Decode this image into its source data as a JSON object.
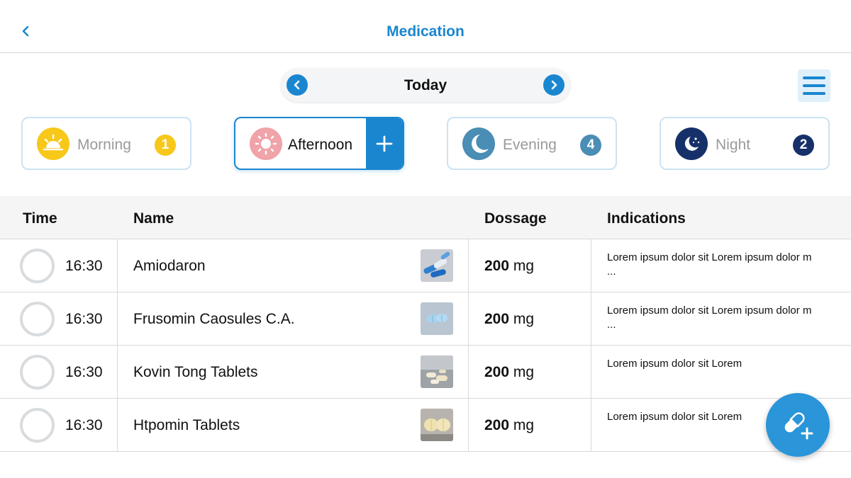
{
  "header": {
    "title": "Medication",
    "back_icon": "chevron-left-icon"
  },
  "date_nav": {
    "label": "Today",
    "prev_icon": "chevron-left-icon",
    "next_icon": "chevron-right-icon"
  },
  "menu_icon": "hamburger-menu-icon",
  "periods": [
    {
      "label": "Morning",
      "count": "1",
      "icon": "sunrise-icon",
      "icon_color": "#f7c81a",
      "badge_color": "#f7c81a",
      "active": false
    },
    {
      "label": "Afternoon",
      "count": "",
      "icon": "sun-icon",
      "icon_color": "#f0a3a8",
      "badge_color": "",
      "active": true,
      "add_icon": "plus-icon"
    },
    {
      "label": "Evening",
      "count": "4",
      "icon": "moon-icon",
      "icon_color": "#4a8db5",
      "badge_color": "#4a8db5",
      "active": false
    },
    {
      "label": "Night",
      "count": "2",
      "icon": "moon-stars-icon",
      "icon_color": "#16306a",
      "badge_color": "#16306a",
      "active": false
    }
  ],
  "table": {
    "headers": {
      "time": "Time",
      "name": "Name",
      "dosage": "Dossage",
      "indications": "Indications"
    },
    "rows": [
      {
        "time": "16:30",
        "name": "Amiodaron",
        "dose_value": "200",
        "dose_unit": "mg",
        "indications": "Lorem ipsum dolor sit Lorem ipsum dolor m ...",
        "image": "blue-capsules-image"
      },
      {
        "time": "16:30",
        "name": "Frusomin Caosules C.A.",
        "dose_value": "200",
        "dose_unit": "mg",
        "indications": "Lorem ipsum dolor sit Lorem ipsum dolor m ...",
        "image": "blue-tablets-image"
      },
      {
        "time": "16:30",
        "name": "Kovin Tong Tablets",
        "dose_value": "200",
        "dose_unit": "mg",
        "indications": "Lorem ipsum dolor sit Lorem",
        "image": "white-pills-image"
      },
      {
        "time": "16:30",
        "name": "Htpomin Tablets",
        "dose_value": "200",
        "dose_unit": "mg",
        "indications": "Lorem ipsum dolor sit Lorem",
        "image": "yellow-tablets-image"
      }
    ]
  },
  "fab_icon": "add-pill-icon",
  "colors": {
    "accent": "#1a86cf",
    "fab": "#2a95d8"
  }
}
